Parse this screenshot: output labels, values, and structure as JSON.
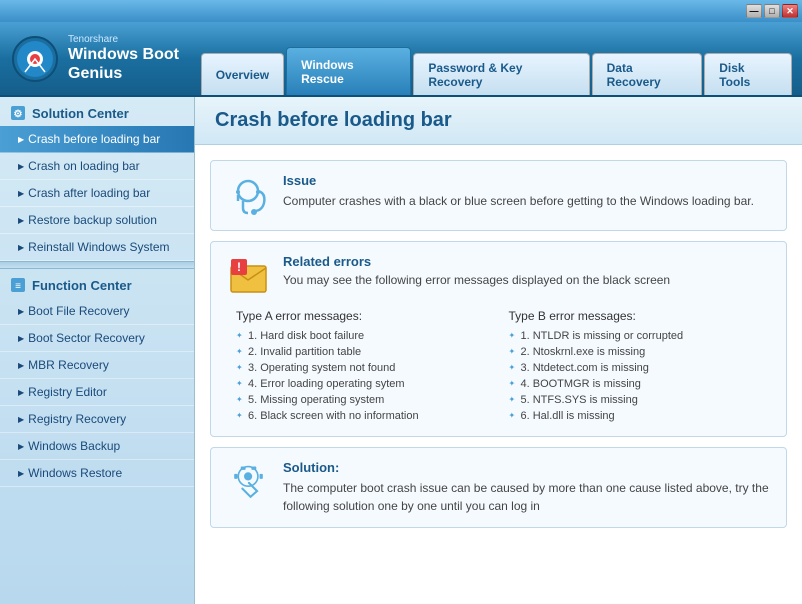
{
  "titlebar": {
    "minimize_label": "—",
    "maximize_label": "□",
    "close_label": "✕"
  },
  "header": {
    "brand": "Tenorshare",
    "product_line1": "Windows Boot",
    "product_line2": "Genius",
    "tabs": [
      {
        "id": "overview",
        "label": "Overview",
        "active": false
      },
      {
        "id": "windows-rescue",
        "label": "Windows Rescue",
        "active": true
      },
      {
        "id": "password-key",
        "label": "Password & Key Recovery",
        "active": false
      },
      {
        "id": "data-recovery",
        "label": "Data Recovery",
        "active": false
      },
      {
        "id": "disk-tools",
        "label": "Disk Tools",
        "active": false
      }
    ]
  },
  "sidebar": {
    "solution_center_label": "Solution Center",
    "items_solution": [
      {
        "id": "crash-before",
        "label": "Crash before loading bar",
        "active": true
      },
      {
        "id": "crash-on",
        "label": "Crash on loading bar",
        "active": false
      },
      {
        "id": "crash-after",
        "label": "Crash after loading bar",
        "active": false
      },
      {
        "id": "restore-backup",
        "label": "Restore backup solution",
        "active": false
      },
      {
        "id": "reinstall-windows",
        "label": "Reinstall Windows System",
        "active": false
      }
    ],
    "function_center_label": "Function Center",
    "items_function": [
      {
        "id": "boot-file",
        "label": "Boot File Recovery",
        "active": false
      },
      {
        "id": "boot-sector",
        "label": "Boot Sector Recovery",
        "active": false
      },
      {
        "id": "mbr-recovery",
        "label": "MBR Recovery",
        "active": false
      },
      {
        "id": "registry-editor",
        "label": "Registry Editor",
        "active": false
      },
      {
        "id": "registry-recovery",
        "label": "Registry Recovery",
        "active": false
      },
      {
        "id": "windows-backup",
        "label": "Windows Backup",
        "active": false
      },
      {
        "id": "windows-restore",
        "label": "Windows Restore",
        "active": false
      }
    ]
  },
  "content": {
    "page_title": "Crash before loading bar",
    "issue": {
      "title": "Issue",
      "text": "Computer crashes with a black or blue screen before getting to the Windows loading bar."
    },
    "related_errors": {
      "title": "Related errors",
      "subtitle": "You may see the following error messages displayed on the black screen",
      "type_a_label": "Type A error messages:",
      "type_a_items": [
        "1. Hard disk boot failure",
        "2. Invalid partition table",
        "3. Operating system not found",
        "4. Error loading operating sytem",
        "5. Missing operating system",
        "6. Black screen with no information"
      ],
      "type_b_label": "Type B error messages:",
      "type_b_items": [
        "1. NTLDR is missing or corrupted",
        "2. Ntoskrnl.exe is missing",
        "3. Ntdetect.com is missing",
        "4. BOOTMGR is missing",
        "5. NTFS.SYS is missing",
        "6. Hal.dll is missing"
      ]
    },
    "solution": {
      "title": "Solution:",
      "text": "The computer boot crash issue can be caused by more than one cause listed above, try the following solution one by one until you can log in"
    }
  }
}
